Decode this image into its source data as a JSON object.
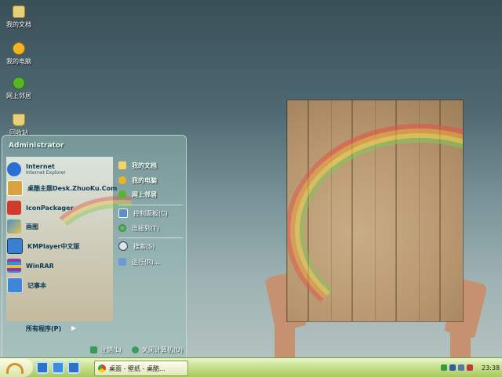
{
  "desktop_icons": [
    {
      "label": "我的文档",
      "icon": "folder-icon",
      "color": "#e8d07a"
    },
    {
      "label": "我的电脑",
      "icon": "computer-icon",
      "color": "#f2b522"
    },
    {
      "label": "网上邻居",
      "icon": "network-icon",
      "color": "#57b52a"
    },
    {
      "label": "回收站",
      "icon": "recycle-bin-icon",
      "color": "#e8d07a"
    }
  ],
  "start_menu": {
    "user_name": "Administrator",
    "programs": [
      {
        "label": "Internet",
        "sublabel": "Internet Explorer",
        "icon": "internet-explorer-icon",
        "color": "#2a6fd6"
      },
      {
        "label": "桌酷主题Desk.ZhuoKu.Com",
        "icon": "theme-app-icon",
        "color": "#d8a442"
      },
      {
        "label": "IconPackager",
        "icon": "iconpackager-icon",
        "color": "#d03b2a"
      },
      {
        "label": "画图",
        "icon": "paint-icon",
        "color": "#4a8fd0"
      },
      {
        "label": "KMPlayer中文版",
        "icon": "kmplayer-icon",
        "color": "#3b7fcf"
      },
      {
        "label": "WinRAR",
        "icon": "winrar-icon",
        "color": "#8e3aa0"
      },
      {
        "label": "记事本",
        "icon": "notepad-icon",
        "color": "#3f86d8"
      }
    ],
    "all_programs": "所有程序(P)",
    "right_items": [
      {
        "label": "我的文档",
        "icon": "folder-icon",
        "color": "#f3d561"
      },
      {
        "label": "我的电脑",
        "icon": "computer-icon",
        "color": "#f2b522"
      },
      {
        "label": "网上邻居",
        "icon": "network-icon",
        "color": "#57b52a"
      },
      {
        "label": "控制面板(C)",
        "icon": "control-panel-icon",
        "color": "#5b8ed0"
      },
      {
        "label": "连接到(T)",
        "icon": "connect-icon",
        "color": "#3aa03a"
      },
      {
        "label": "搜索(S)",
        "icon": "search-icon",
        "color": "#d8e4f0"
      },
      {
        "label": "运行(R)...",
        "icon": "run-icon",
        "color": "#6a9ad8"
      }
    ],
    "logoff": "注销(L)",
    "shutdown": "关闭计算机(U)"
  },
  "taskbar": {
    "task_label": "桌面 - 壁纸 - 桌酷...",
    "clock": "23:38",
    "accent": "#a9c95e"
  }
}
